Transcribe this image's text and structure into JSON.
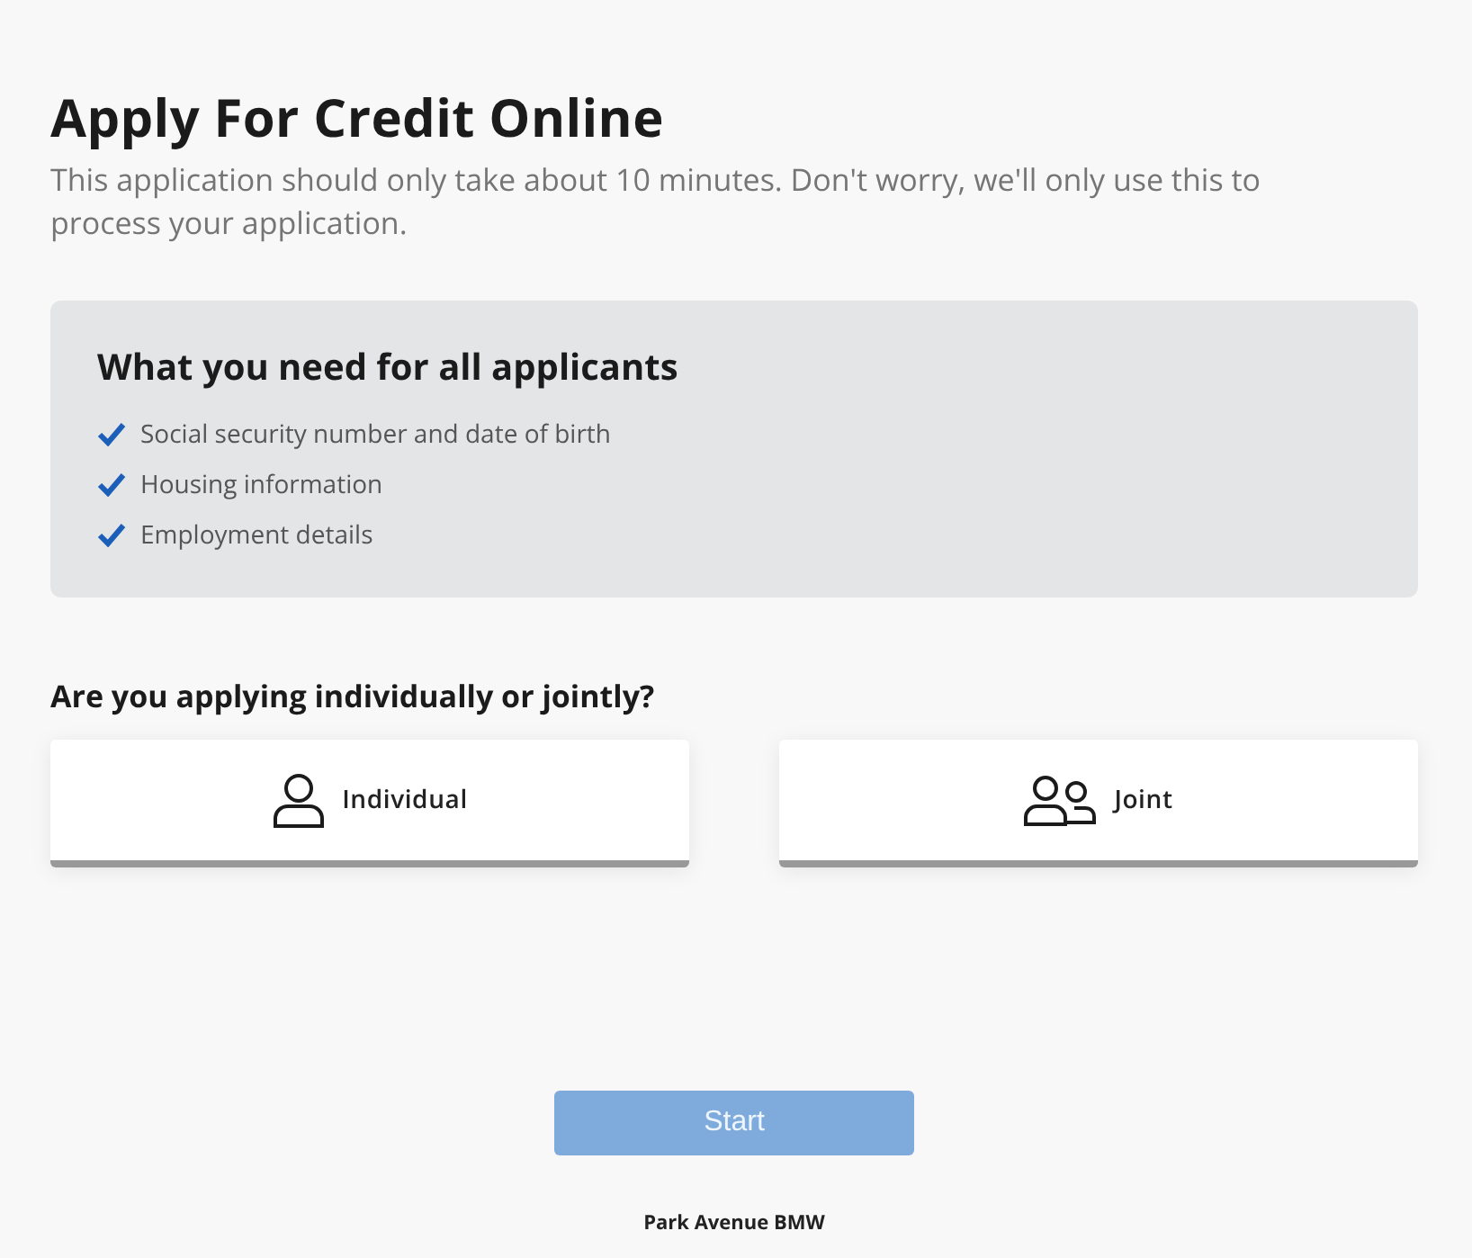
{
  "title": "Apply For Credit Online",
  "subtitle": "This application should only take about 10 minutes. Don't worry, we'll only use this to process your application.",
  "requirements": {
    "heading": "What you need for all applicants",
    "items": [
      {
        "label": "Social security number and date of birth",
        "checked": true
      },
      {
        "label": "Housing information",
        "checked": true
      },
      {
        "label": "Employment details",
        "checked": true
      }
    ]
  },
  "question": "Are you applying individually or jointly?",
  "options": [
    {
      "kind": "individual",
      "label": "Individual",
      "selected": false
    },
    {
      "kind": "joint",
      "label": "Joint",
      "selected": false
    }
  ],
  "start_button": {
    "label": "Start",
    "disabled": true
  },
  "footer": "Park Avenue BMW"
}
